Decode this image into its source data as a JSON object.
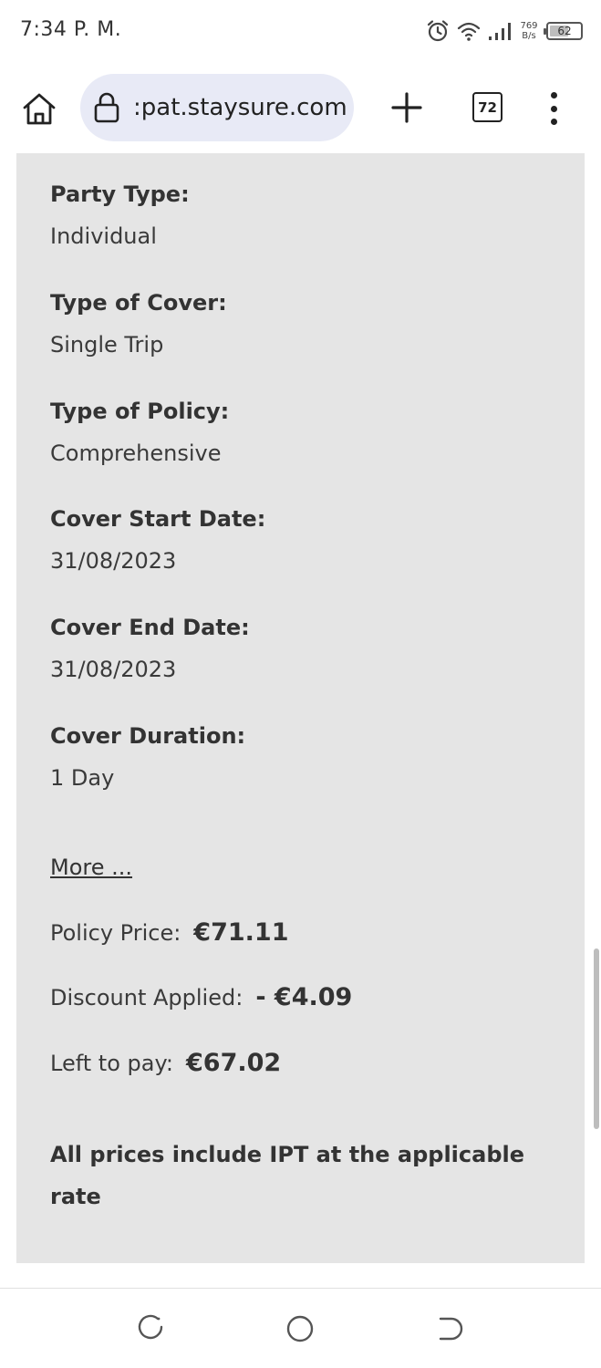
{
  "status_bar": {
    "time": "7:34 P. M.",
    "net_speed_value": "769",
    "net_speed_unit": "B/s",
    "battery_level": "62",
    "icons": [
      "alarm-icon",
      "wifi-icon",
      "signal-icon",
      "battery-icon"
    ]
  },
  "browser": {
    "url": ":pat.staysure.com",
    "tab_count": "72",
    "icons": [
      "home-icon",
      "lock-icon",
      "plus-icon",
      "tabs-icon",
      "more-vert-icon"
    ]
  },
  "policy": {
    "fields": [
      {
        "label": "Party Type:",
        "value": "Individual"
      },
      {
        "label": "Type of Cover:",
        "value": "Single Trip"
      },
      {
        "label": "Type of Policy:",
        "value": "Comprehensive"
      },
      {
        "label": "Cover Start Date:",
        "value": "31/08/2023"
      },
      {
        "label": "Cover End Date:",
        "value": "31/08/2023"
      },
      {
        "label": "Cover Duration:",
        "value": "1 Day"
      }
    ],
    "more_link": "More ...",
    "prices": [
      {
        "label": "Policy Price:",
        "amount": "€71.11"
      },
      {
        "label": "Discount Applied:",
        "amount": "- €4.09"
      },
      {
        "label": "Left to pay:",
        "amount": "€67.02"
      }
    ],
    "disclaimer": "All prices include IPT at the applicable rate"
  },
  "battery_fraction": 0.62,
  "colors": {
    "panel_background": "#e5e5e5",
    "url_pill_background": "#e8eaf6",
    "text": "#333333"
  }
}
